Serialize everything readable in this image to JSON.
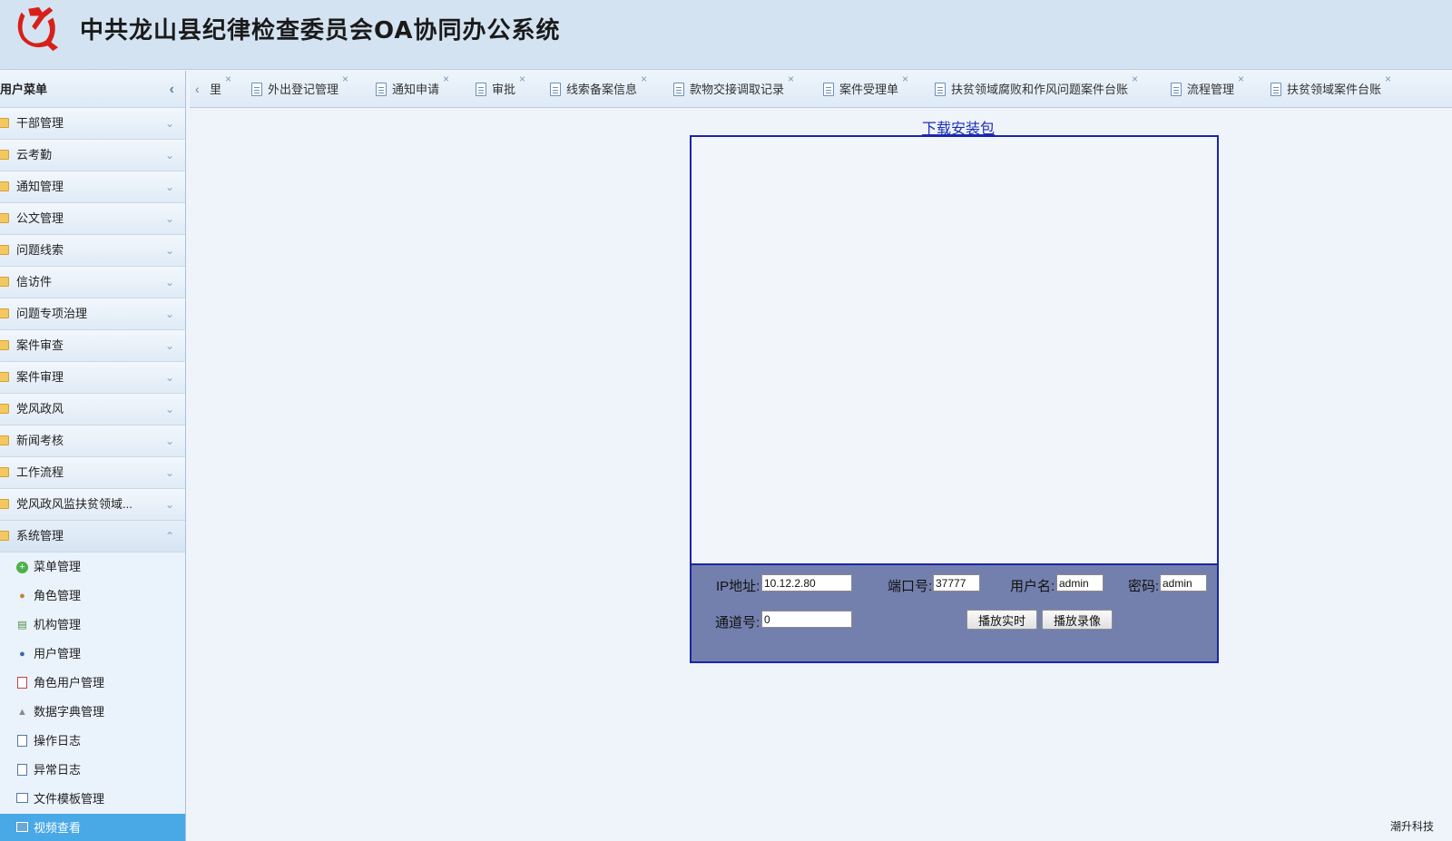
{
  "header": {
    "title": "中共龙山县纪律检查委员会OA协同办公系统",
    "logo_icon": "party-emblem-icon",
    "accent": "#d7201b"
  },
  "sidebar": {
    "title": "用户菜单",
    "groups": [
      {
        "label": "干部管理"
      },
      {
        "label": "云考勤"
      },
      {
        "label": "通知管理"
      },
      {
        "label": "公文管理"
      },
      {
        "label": "问题线索"
      },
      {
        "label": "信访件"
      },
      {
        "label": "问题专项治理"
      },
      {
        "label": "案件审查"
      },
      {
        "label": "案件审理"
      },
      {
        "label": "党风政风"
      },
      {
        "label": "新闻考核"
      },
      {
        "label": "工作流程"
      },
      {
        "label": "党风政风监扶贫领域..."
      },
      {
        "label": "系统管理"
      }
    ],
    "sub_items": [
      {
        "label": "菜单管理",
        "icon": "plus-circle-icon"
      },
      {
        "label": "角色管理",
        "icon": "role-icon"
      },
      {
        "label": "机构管理",
        "icon": "org-tree-icon"
      },
      {
        "label": "用户管理",
        "icon": "user-icon"
      },
      {
        "label": "角色用户管理",
        "icon": "role-user-icon"
      },
      {
        "label": "数据字典管理",
        "icon": "dictionary-icon"
      },
      {
        "label": "操作日志",
        "icon": "log-icon"
      },
      {
        "label": "异常日志",
        "icon": "error-log-icon"
      },
      {
        "label": "文件模板管理",
        "icon": "template-icon"
      },
      {
        "label": "视频查看",
        "icon": "video-icon"
      }
    ],
    "active_color": "#49a8e6"
  },
  "tabs": {
    "items": [
      {
        "label": "里"
      },
      {
        "label": "外出登记管理"
      },
      {
        "label": "通知申请"
      },
      {
        "label": "审批"
      },
      {
        "label": "线索备案信息"
      },
      {
        "label": "款物交接调取记录"
      },
      {
        "label": "案件受理单"
      },
      {
        "label": "扶贫领域腐败和作风问题案件台账"
      },
      {
        "label": "流程管理"
      },
      {
        "label": "扶贫领域案件台账"
      }
    ]
  },
  "content": {
    "download_link": "下载安装包",
    "controls": {
      "ip_label": "IP地址:",
      "ip_value": "10.12.2.80",
      "port_label": "端口号:",
      "port_value": "37777",
      "user_label": "用户名:",
      "user_value": "admin",
      "pwd_label": "密码:",
      "pwd_value": "admin",
      "channel_label": "通道号:",
      "channel_value": "0",
      "play_live": "播放实时",
      "play_record": "播放录像"
    }
  },
  "footer": {
    "brand": "潮升科技"
  }
}
